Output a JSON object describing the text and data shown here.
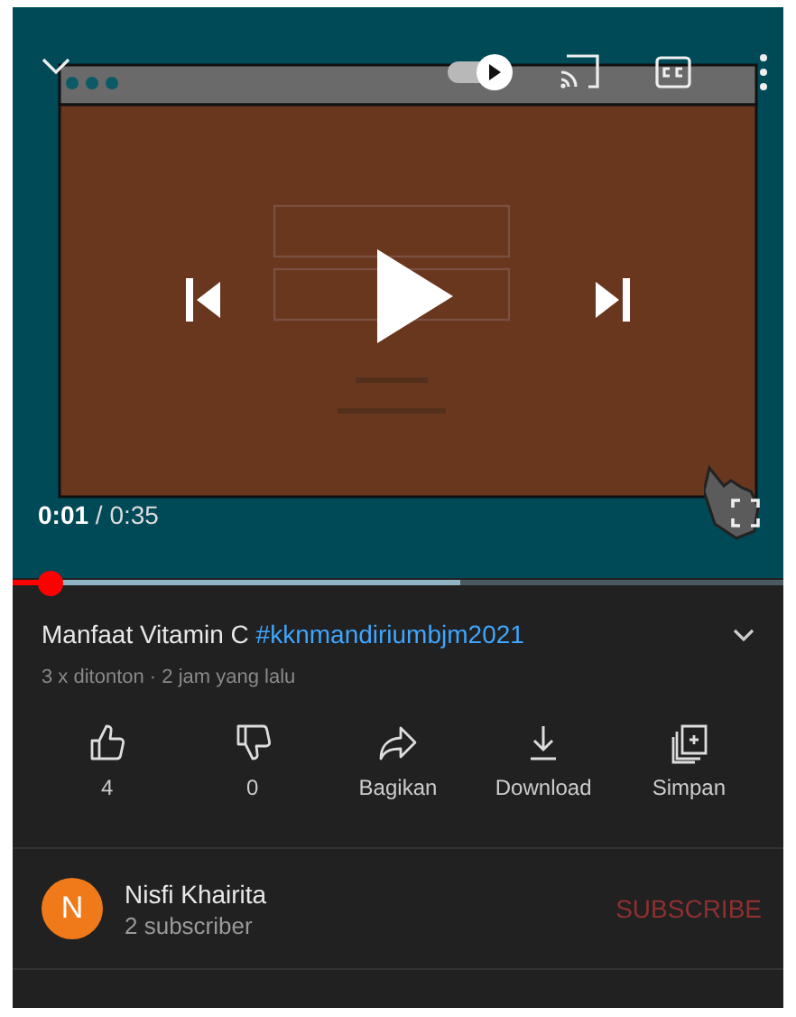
{
  "player": {
    "autoplay": {
      "on": true
    },
    "time": "**0:01** / 0:35",
    "progress": {
      "level": 0.05
    }
  },
  "video": {
    "title": "Manfaat Vitamin C",
    "hashtag": "#kknmandiriumbjm2021",
    "meta": "3 x ditonton · 2 jam yang lalu"
  },
  "actions": [
    {
      "kind": "like",
      "label": "4"
    },
    {
      "kind": "dislike",
      "label": "0"
    },
    {
      "kind": "share",
      "label": "Bagikan"
    },
    {
      "kind": "download",
      "label": "Download"
    },
    {
      "kind": "save",
      "label": "Simpan"
    }
  ],
  "channel": {
    "avatar_letter": "N",
    "name": "Nisfi Khairita",
    "subscribers": "2 subscriber",
    "subscribe_label": "SUBSCRIBE"
  }
}
